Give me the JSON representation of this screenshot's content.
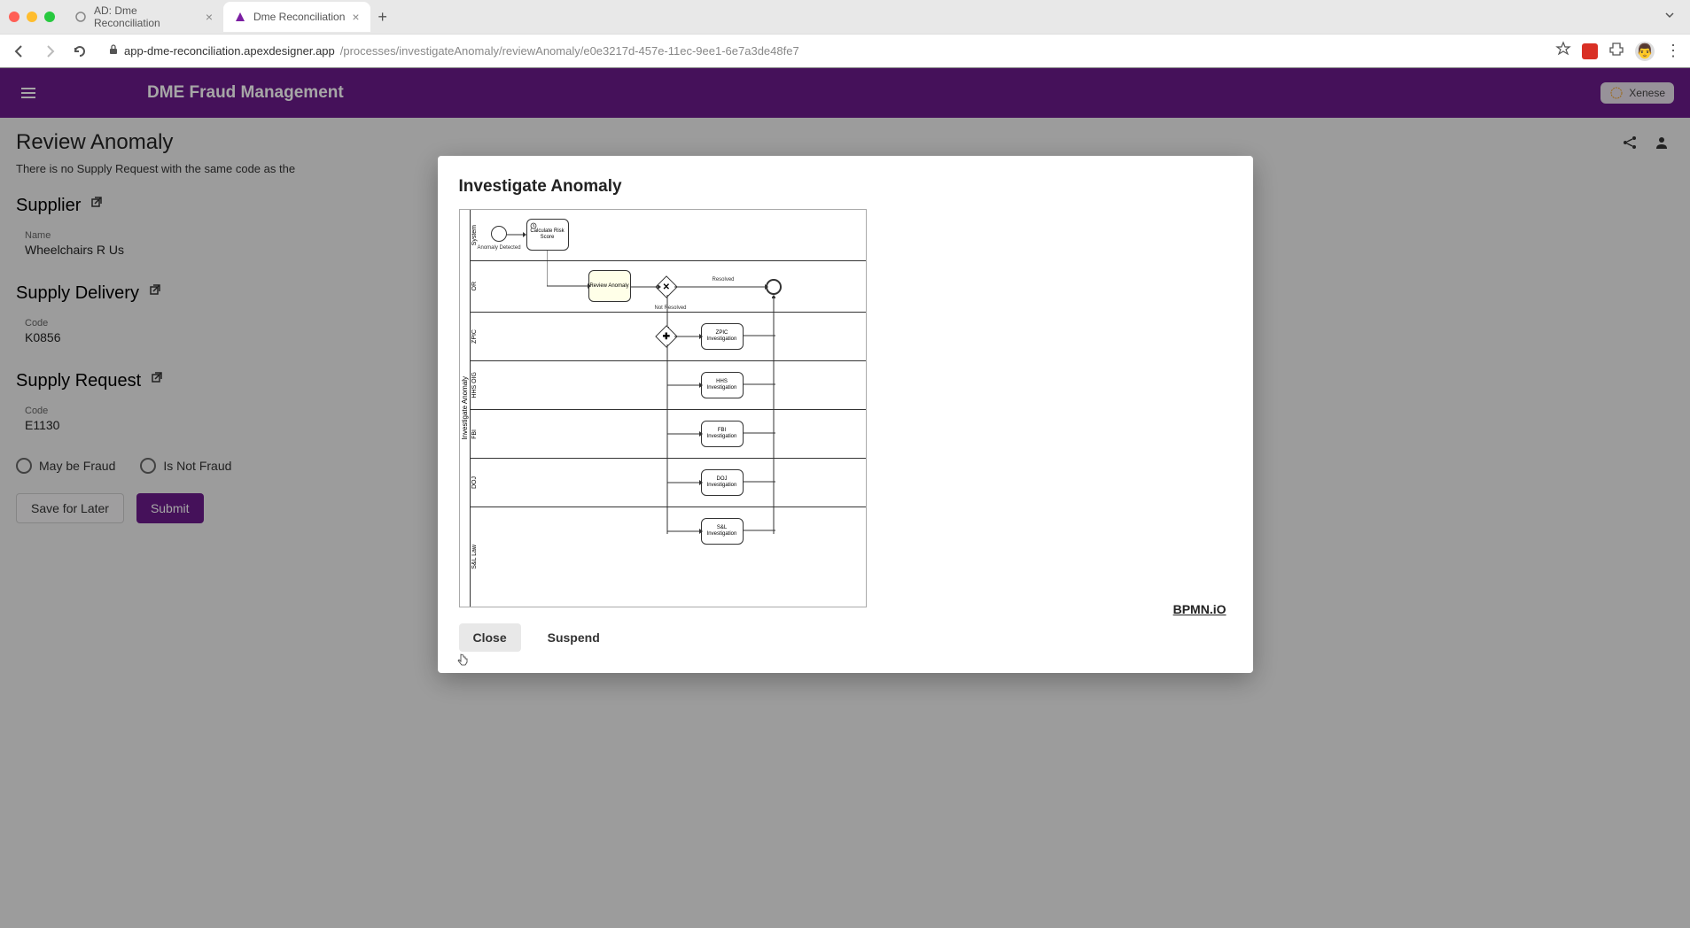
{
  "browser": {
    "tabs": [
      {
        "title": "AD: Dme Reconciliation",
        "active": false
      },
      {
        "title": "Dme Reconciliation",
        "active": true
      }
    ],
    "url_domain": "app-dme-reconciliation.apexdesigner.app",
    "url_path": "/processes/investigateAnomaly/reviewAnomaly/e0e3217d-457e-11ec-9ee1-6e7a3de48fe7"
  },
  "header": {
    "app_title": "DME Fraud Management",
    "badge": "Xenese"
  },
  "page": {
    "title": "Review Anomaly",
    "info_text": "There is no Supply Request with the same code as the",
    "sections": {
      "supplier": {
        "heading": "Supplier",
        "fields": {
          "name_label": "Name",
          "name_value": "Wheelchairs R Us"
        }
      },
      "supply_delivery": {
        "heading": "Supply Delivery",
        "fields": {
          "code_label": "Code",
          "code_value": "K0856"
        }
      },
      "supply_request": {
        "heading": "Supply Request",
        "fields": {
          "code_label": "Code",
          "code_value": "E1130"
        }
      }
    },
    "radio": {
      "opt1": "May be Fraud",
      "opt2": "Is Not Fraud"
    },
    "buttons": {
      "save": "Save for Later",
      "submit": "Submit"
    }
  },
  "modal": {
    "title": "Investigate Anomaly",
    "bpmn_logo": "BPMN.iO",
    "actions": {
      "close": "Close",
      "suspend": "Suspend"
    },
    "diagram": {
      "pool": "Investigate Anomaly",
      "lanes": [
        "System",
        "OR",
        "ZPIC",
        "HHS OIG",
        "FBI",
        "DOJ",
        "S&L Law"
      ],
      "start_event_label": "Anomaly Detected",
      "tasks": {
        "calc": "Calculate Risk Score",
        "review": "Review Anomaly",
        "zpic": "ZPIC Investigation",
        "hhs": "HHS Investigation",
        "fbi": "FBI Investigation",
        "doj": "DOJ Investigation",
        "sl": "S&L Investigation"
      },
      "gateway_labels": {
        "resolved": "Resolved",
        "not_resolved": "Not Resolved"
      }
    }
  }
}
